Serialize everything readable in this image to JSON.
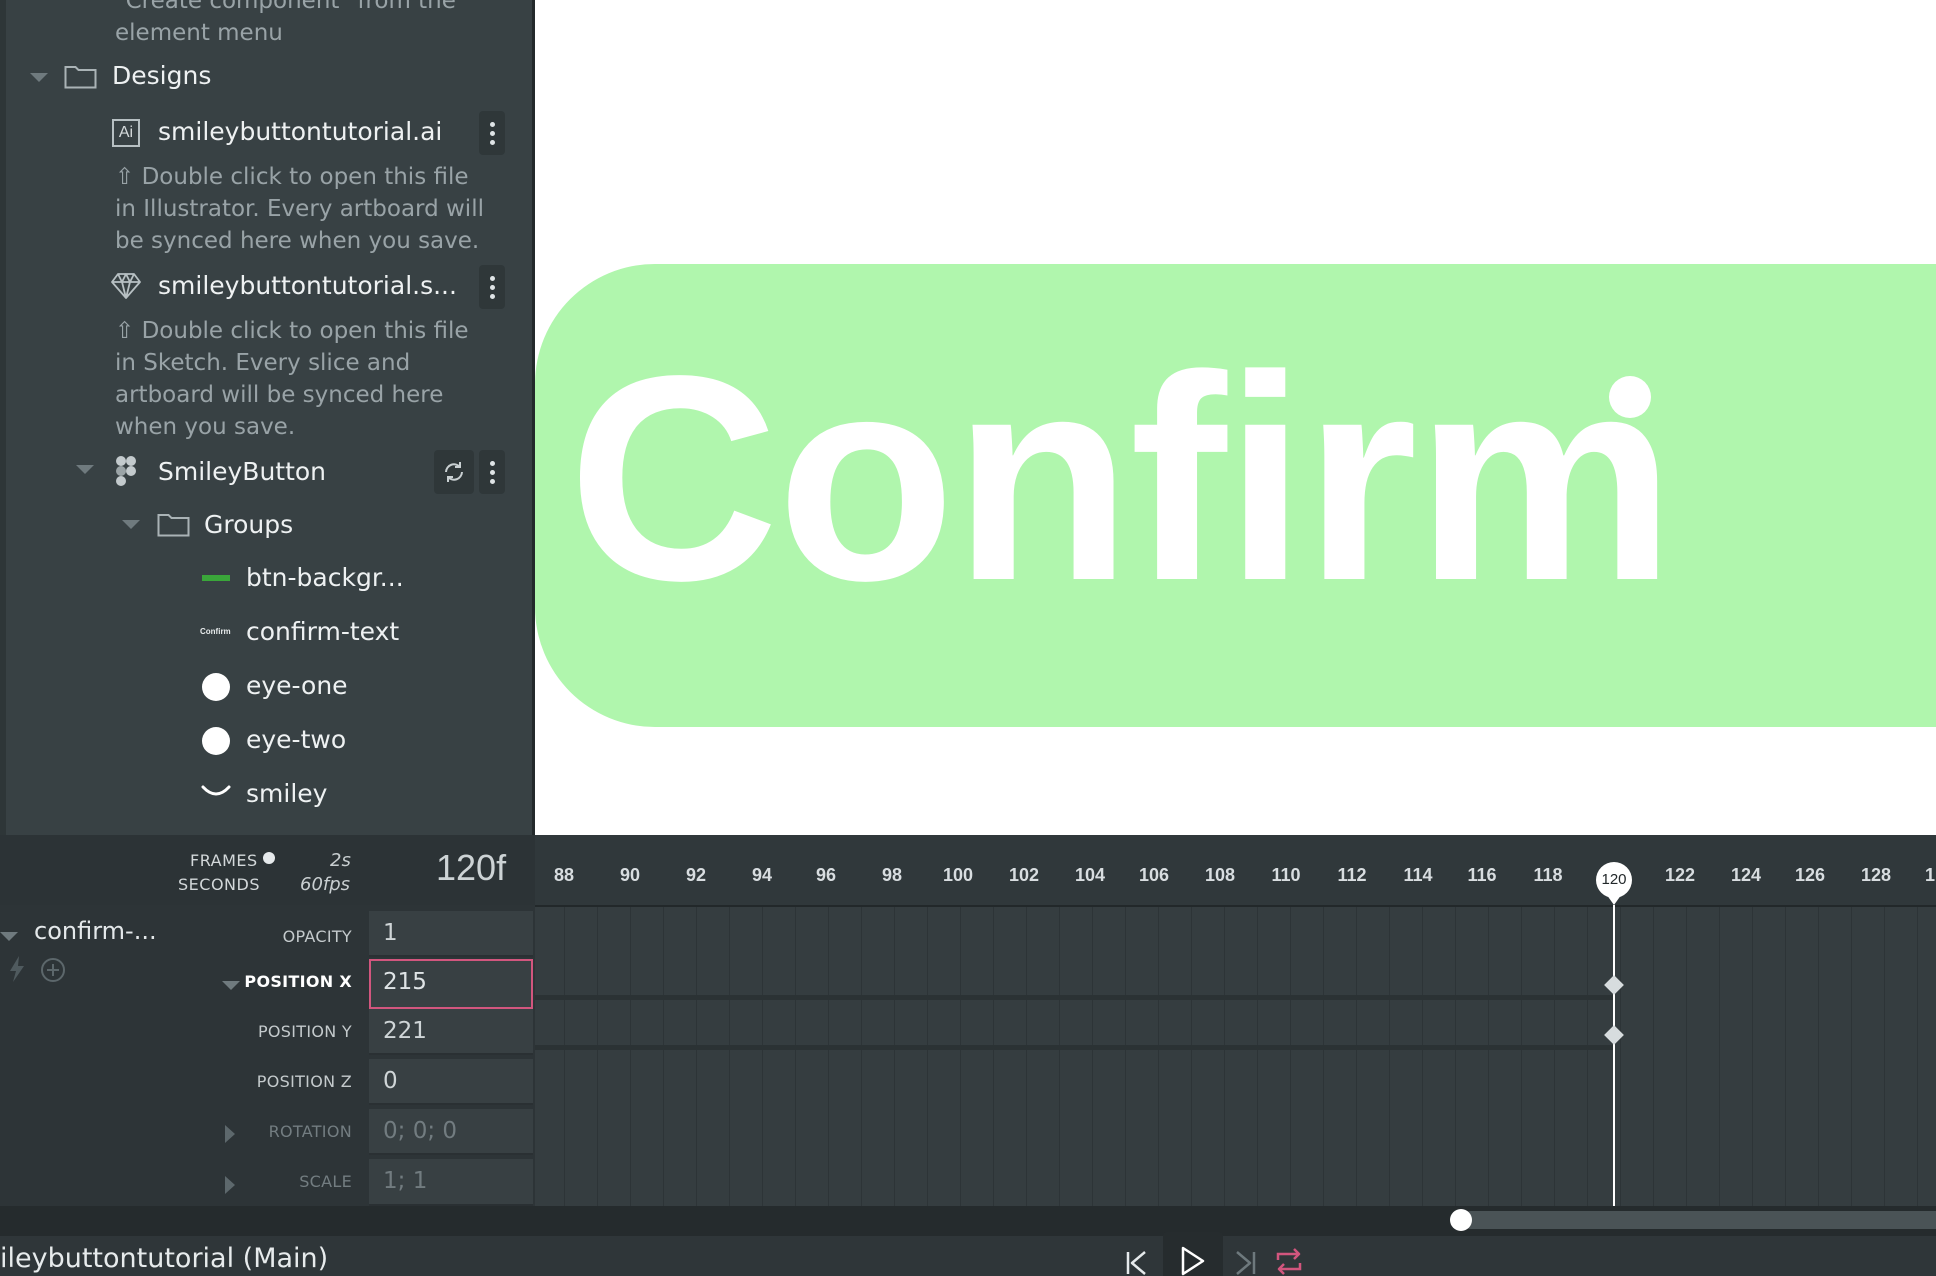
{
  "library": {
    "note_components": "\"Create component\" from the element menu",
    "designs_label": "Designs",
    "files": [
      {
        "badge": "Ai",
        "name": "smileybuttontutorial.ai",
        "note_lines": [
          "⇧ Double click to open this file",
          "in Illustrator. Every artboard will",
          "be synced here when you save."
        ]
      },
      {
        "badge": "sketch",
        "name": "smileybuttontutorial.s...",
        "note_lines": [
          "⇧ Double click to open this file",
          "in Sketch. Every slice and",
          "artboard will be synced here",
          "when you save."
        ]
      }
    ],
    "figma_item": "SmileyButton",
    "groups_label": "Groups",
    "layers": [
      "btn-backgr...",
      "confirm-text",
      "eye-one",
      "eye-two",
      "smiley"
    ],
    "confirm_thumb": "Confirm"
  },
  "stage": {
    "button_text": "Confirm",
    "button_color": "#b0f6ad"
  },
  "timeline": {
    "frames_label": "FRAMES",
    "seconds_label": "SECONDS",
    "duration": "2s",
    "fps": "60fps",
    "current_frames": "120f",
    "ticks": [
      "88",
      "90",
      "92",
      "94",
      "96",
      "98",
      "100",
      "102",
      "104",
      "106",
      "108",
      "110",
      "112",
      "114",
      "116",
      "118",
      "120",
      "122",
      "124",
      "126",
      "128",
      "1"
    ],
    "playhead": "120",
    "element_name": "confirm-...",
    "properties": [
      {
        "label": "OPACITY",
        "value": "1"
      },
      {
        "label": "POSITION X",
        "value": "215"
      },
      {
        "label": "POSITION Y",
        "value": "221"
      },
      {
        "label": "POSITION Z",
        "value": "0"
      },
      {
        "label": "ROTATION",
        "value": "0; 0; 0"
      },
      {
        "label": "SCALE",
        "value": "1; 1"
      }
    ],
    "project_title": "ileybuttontutorial (Main)"
  },
  "colors": {
    "accent_pink": "#d2567e",
    "panel": "#384144",
    "green_layer": "#3aa63a"
  }
}
